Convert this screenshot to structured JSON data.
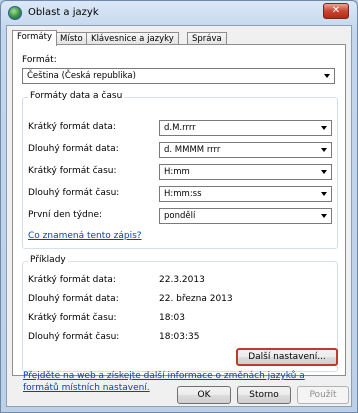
{
  "window": {
    "title": "Oblast a jazyk",
    "close_glyph": "✕"
  },
  "tabs": [
    {
      "label": "Formáty",
      "active": true
    },
    {
      "label": "Místo"
    },
    {
      "label": "Klávesnice a jazyky"
    },
    {
      "label": "Správa"
    }
  ],
  "format": {
    "label": "Formát:",
    "value": "Čeština (Česká republika)"
  },
  "datetime": {
    "legend": "Formáty data a času",
    "rows": [
      {
        "label": "Krátký formát data:",
        "value": "d.M.rrrr"
      },
      {
        "label": "Dlouhý formát data:",
        "value": "d. MMMM rrrr"
      },
      {
        "label": "Krátký formát času:",
        "value": "H:mm"
      },
      {
        "label": "Dlouhý formát času:",
        "value": "H:mm:ss"
      },
      {
        "label": "První den týdne:",
        "value": "pondělí"
      }
    ],
    "help_link": "Co znamená tento zápis?"
  },
  "examples": {
    "legend": "Příklady",
    "rows": [
      {
        "label": "Krátký formát data:",
        "value": "22.3.2013"
      },
      {
        "label": "Dlouhý formát data:",
        "value": "22. března 2013"
      },
      {
        "label": "Krátký formát času:",
        "value": "18:03"
      },
      {
        "label": "Dlouhý formát času:",
        "value": "18:03:35"
      }
    ]
  },
  "more_settings_label": "Další nastavení...",
  "web_link": "Přejděte na web a získejte další informace o změnách jazyků a formátů místních nastavení.",
  "buttons": {
    "ok": "OK",
    "cancel": "Storno",
    "apply": "Použít"
  },
  "colors": {
    "focus_border": "#c0392b",
    "link": "#0645ad",
    "close_button": "#c8452f"
  }
}
